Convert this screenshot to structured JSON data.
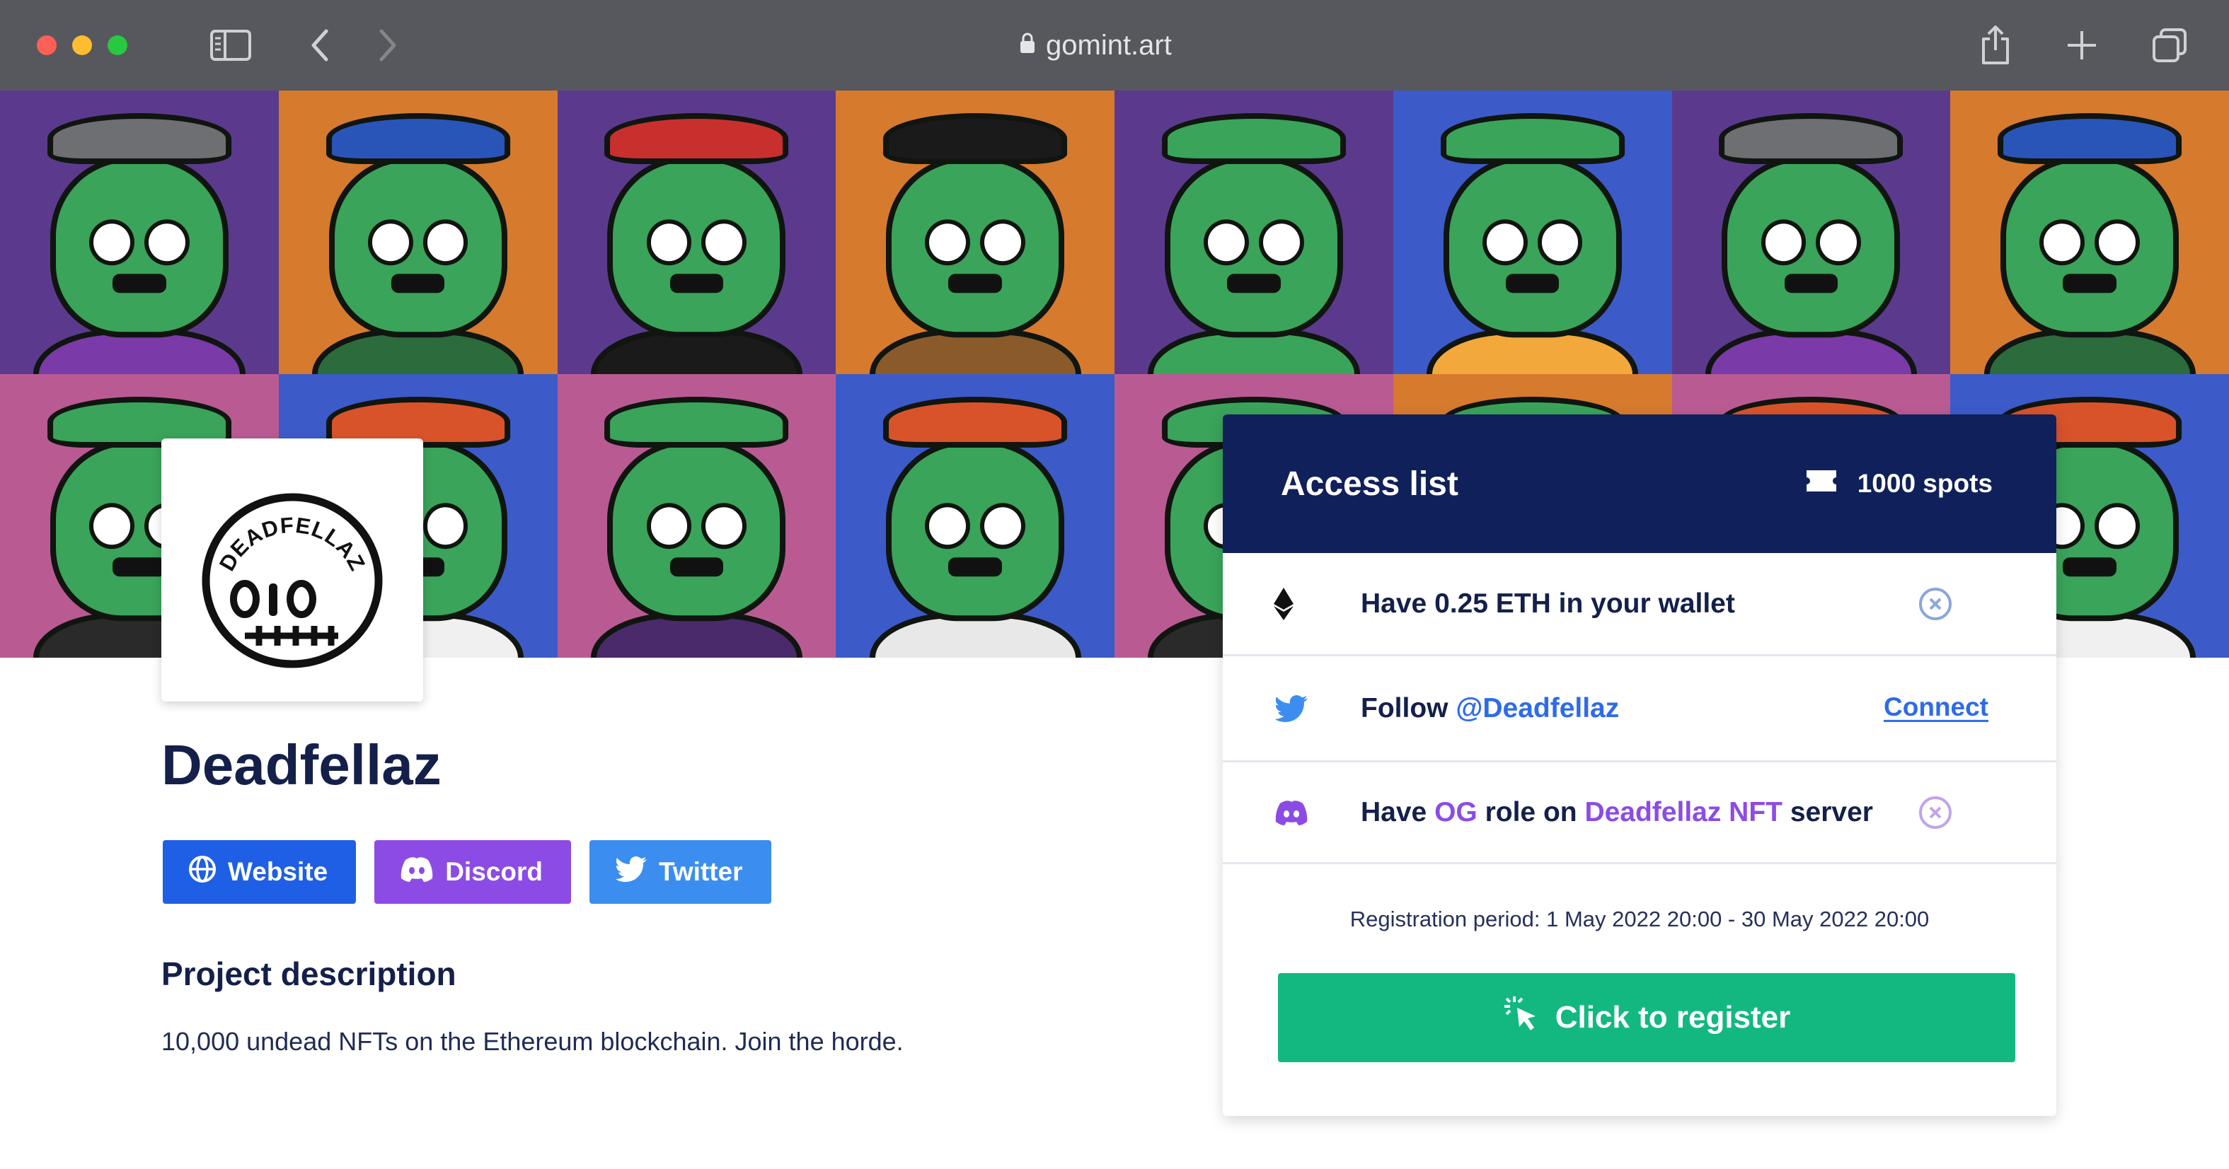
{
  "browser": {
    "url": "gomint.art",
    "icons": [
      "sidebar-icon",
      "back-icon",
      "forward-icon",
      "lock-icon",
      "share-icon",
      "new-tab-icon",
      "tabs-icon"
    ]
  },
  "banner": {
    "tiles": [
      {
        "bg": "#5b3a8e",
        "body": "#7a3aa8",
        "hat": "#6d6f73"
      },
      {
        "bg": "#d67a2e",
        "body": "#2b6b3c",
        "hat": "#2a55b8"
      },
      {
        "bg": "#5b3a8e",
        "body": "#1a1a1a",
        "hat": "#c8302e"
      },
      {
        "bg": "#d67a2e",
        "body": "#8a5a2a",
        "hat": "#1a1a1a"
      },
      {
        "bg": "#5b3a8e",
        "body": "#3aa45a",
        "hat": "#3aa45a"
      },
      {
        "bg": "#3c5bc8",
        "body": "#f2a83a",
        "hat": "#3aa45a"
      },
      {
        "bg": "#5b3a8e",
        "body": "#7a3aa8",
        "hat": "#6d6f73"
      },
      {
        "bg": "#d67a2e",
        "body": "#2b6b3c",
        "hat": "#2a55b8"
      },
      {
        "bg": "#b95b92",
        "body": "#2a2a2a",
        "hat": "#3aa45a"
      },
      {
        "bg": "#3c5bc8",
        "body": "#f0f0f0",
        "hat": "#d9532a"
      },
      {
        "bg": "#b95b92",
        "body": "#4a2a6a",
        "hat": "#3aa45a"
      },
      {
        "bg": "#3c5bc8",
        "body": "#e8e8e8",
        "hat": "#d9532a"
      },
      {
        "bg": "#b95b92",
        "body": "#2a2a2a",
        "hat": "#3aa45a"
      },
      {
        "bg": "#d67a2e",
        "body": "#3aa45a",
        "hat": "#3aa45a"
      },
      {
        "bg": "#b95b92",
        "body": "#2a2a2a",
        "hat": "#d9532a"
      },
      {
        "bg": "#3c5bc8",
        "body": "#f0f0f0",
        "hat": "#d9532a"
      }
    ]
  },
  "logo": {
    "text": "DEADFELLAZ"
  },
  "project": {
    "name": "Deadfellaz",
    "links": [
      {
        "label": "Website",
        "icon": "globe-icon",
        "color": "#1f5fe6"
      },
      {
        "label": "Discord",
        "icon": "discord-icon",
        "color": "#8d4be5"
      },
      {
        "label": "Twitter",
        "icon": "twitter-icon",
        "color": "#3b8ef0"
      }
    ],
    "description_title": "Project description",
    "description": "10,000 undead NFTs on the Ethereum blockchain. Join the horde."
  },
  "access": {
    "title": "Access list",
    "spots": "1000 spots",
    "req1": {
      "prefix": "Have 0.25 ETH in your wallet"
    },
    "req2": {
      "prefix": "Follow ",
      "handle": "@Deadfellaz",
      "action": "Connect"
    },
    "req3": {
      "prefix": "Have ",
      "role": "OG",
      "middle": " role on ",
      "server": "Deadfellaz NFT",
      "suffix": " server"
    },
    "period": "Registration period: 1 May 2022 20:00 - 30 May 2022 20:00",
    "register": "Click to register"
  },
  "colors": {
    "navy": "#10205a",
    "green": "#13b880",
    "blue": "#2e6bea",
    "purple": "#8d4be5"
  }
}
